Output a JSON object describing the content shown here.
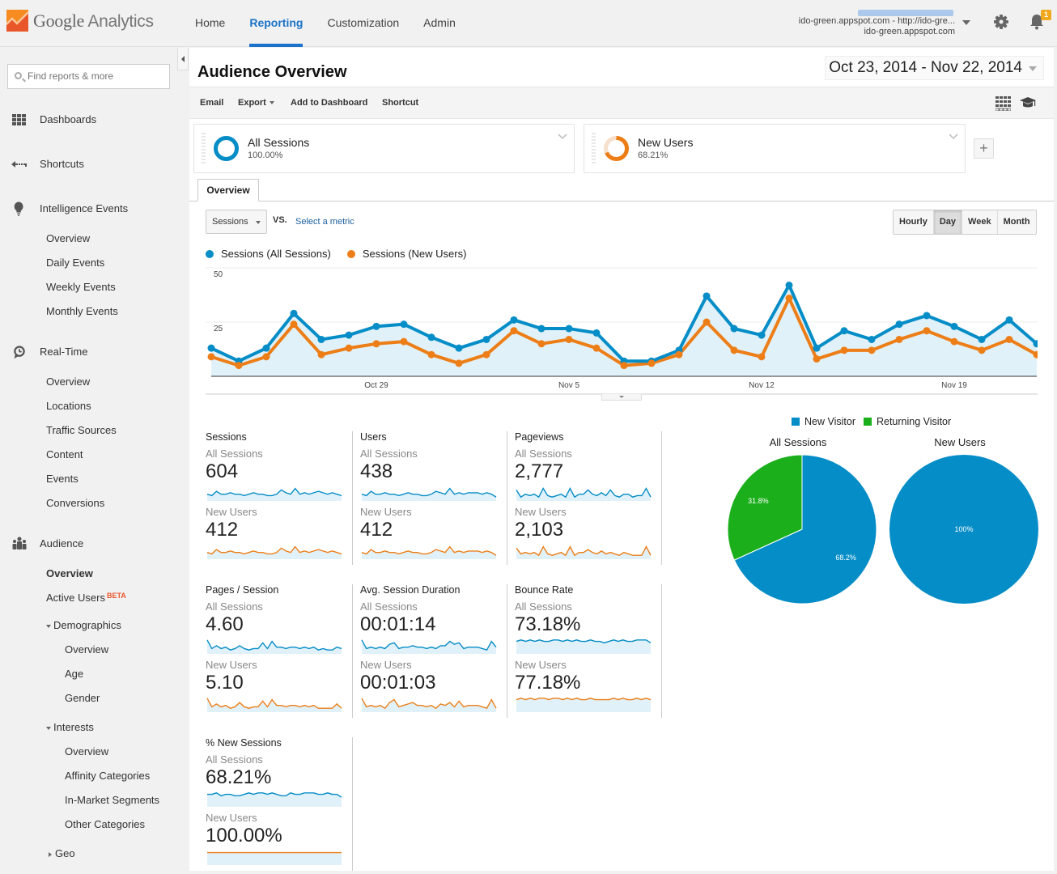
{
  "app": {
    "name_google": "Google",
    "name_analytics": "Analytics"
  },
  "nav": {
    "items": [
      {
        "label": "Home",
        "active": false
      },
      {
        "label": "Reporting",
        "active": true
      },
      {
        "label": "Customization",
        "active": false
      },
      {
        "label": "Admin",
        "active": false
      }
    ]
  },
  "account": {
    "line1": "ido-green.appspot.com - http://ido-gre...",
    "line2": "ido-green.appspot.com",
    "notifications": "1"
  },
  "sidebar": {
    "search_placeholder": "Find reports & more",
    "sections": {
      "dashboards": "Dashboards",
      "shortcuts": "Shortcuts",
      "intelligence": "Intelligence Events",
      "realtime": "Real-Time",
      "audience": "Audience"
    },
    "intelligence_items": [
      "Overview",
      "Daily Events",
      "Weekly Events",
      "Monthly Events"
    ],
    "realtime_items": [
      "Overview",
      "Locations",
      "Traffic Sources",
      "Content",
      "Events",
      "Conversions"
    ],
    "audience_items": {
      "overview": "Overview",
      "active_users": "Active Users",
      "beta": "BETA",
      "demographics": "Demographics",
      "demographics_items": [
        "Overview",
        "Age",
        "Gender"
      ],
      "interests": "Interests",
      "interests_items": [
        "Overview",
        "Affinity Categories",
        "In-Market Segments",
        "Other Categories"
      ],
      "geo": "Geo"
    }
  },
  "page": {
    "title": "Audience Overview",
    "date_range": "Oct 23, 2014 - Nov 22, 2014",
    "toolbar": {
      "email": "Email",
      "export": "Export",
      "add_to_dashboard": "Add to Dashboard",
      "shortcut": "Shortcut"
    },
    "segments": [
      {
        "name": "All Sessions",
        "percent": "100.00%",
        "fraction": 1.0,
        "color": "#058dc7"
      },
      {
        "name": "New Users",
        "percent": "68.21%",
        "fraction": 0.6821,
        "color": "#ed7e17"
      }
    ],
    "tab": "Overview",
    "metric_select": "Sessions",
    "vs": "VS.",
    "select_metric": "Select a metric",
    "granularity": [
      {
        "label": "Hourly",
        "active": false
      },
      {
        "label": "Day",
        "active": true
      },
      {
        "label": "Week",
        "active": false
      },
      {
        "label": "Month",
        "active": false
      }
    ]
  },
  "chart_data": [
    {
      "type": "line",
      "title": "",
      "xlabel": "",
      "ylabel": "",
      "ylim": [
        0,
        50
      ],
      "yticks": [
        25,
        50
      ],
      "grid": true,
      "legend": "top-left",
      "x_tick_labels": [
        {
          "label": "Oct 29",
          "index": 6
        },
        {
          "label": "Nov 5",
          "index": 13
        },
        {
          "label": "Nov 12",
          "index": 20
        },
        {
          "label": "Nov 19",
          "index": 27
        }
      ],
      "x": [
        "Oct 23",
        "Oct 24",
        "Oct 25",
        "Oct 26",
        "Oct 27",
        "Oct 28",
        "Oct 29",
        "Oct 30",
        "Oct 31",
        "Nov 1",
        "Nov 2",
        "Nov 3",
        "Nov 4",
        "Nov 5",
        "Nov 6",
        "Nov 7",
        "Nov 8",
        "Nov 9",
        "Nov 10",
        "Nov 11",
        "Nov 12",
        "Nov 13",
        "Nov 14",
        "Nov 15",
        "Nov 16",
        "Nov 17",
        "Nov 18",
        "Nov 19",
        "Nov 20",
        "Nov 21",
        "Nov 22"
      ],
      "series": [
        {
          "name": "Sessions (All Sessions)",
          "color": "#058dc7",
          "values": [
            13,
            7,
            13,
            29,
            17,
            19,
            23,
            24,
            18,
            13,
            17,
            26,
            22,
            22,
            20,
            7,
            7,
            12,
            37,
            22,
            19,
            42,
            13,
            21,
            17,
            24,
            28,
            23,
            17,
            26,
            15
          ]
        },
        {
          "name": "Sessions (New Users)",
          "color": "#ed7e17",
          "values": [
            9,
            5,
            9,
            24,
            10,
            13,
            15,
            16,
            10,
            6,
            10,
            21,
            15,
            17,
            13,
            5,
            6,
            10,
            25,
            12,
            9,
            36,
            8,
            12,
            12,
            17,
            21,
            16,
            12,
            17,
            10
          ]
        }
      ]
    },
    {
      "type": "pie",
      "legend": "top",
      "legend_entries": [
        {
          "name": "New Visitor",
          "color": "#058dc7"
        },
        {
          "name": "Returning Visitor",
          "color": "#1caf1c"
        }
      ],
      "pies": [
        {
          "title": "All Sessions",
          "slices": [
            {
              "name": "New Visitor",
              "value": 68.2,
              "label": "68.2%"
            },
            {
              "name": "Returning Visitor",
              "value": 31.8,
              "label": "31.8%"
            }
          ]
        },
        {
          "title": "New Users",
          "slices": [
            {
              "name": "New Visitor",
              "value": 100,
              "label": "100%"
            }
          ]
        }
      ]
    }
  ],
  "stats": [
    {
      "key": "sessions",
      "title": "Sessions",
      "seg1": "All Sessions",
      "val1": "604",
      "seg2": "New Users",
      "val2": "412",
      "spark1": [
        3,
        2,
        5,
        3,
        3,
        4,
        3,
        3,
        2,
        3,
        4,
        3,
        3,
        2,
        2,
        3,
        6,
        4,
        3,
        7,
        3,
        4,
        3,
        4,
        5,
        4,
        3,
        4,
        3,
        2
      ],
      "spark2": [
        3,
        2,
        5,
        3,
        3,
        4,
        3,
        3,
        2,
        3,
        4,
        3,
        3,
        2,
        2,
        3,
        6,
        4,
        3,
        7,
        3,
        4,
        3,
        4,
        5,
        4,
        3,
        4,
        3,
        2
      ]
    },
    {
      "key": "users",
      "title": "Users",
      "seg1": "All Sessions",
      "val1": "438",
      "seg2": "New Users",
      "val2": "412",
      "spark1": [
        3,
        2,
        5,
        3,
        3,
        4,
        3,
        3,
        2,
        3,
        4,
        3,
        3,
        2,
        2,
        3,
        5,
        4,
        3,
        7,
        3,
        4,
        3,
        4,
        4,
        4,
        3,
        4,
        3,
        1
      ],
      "spark2": [
        3,
        2,
        5,
        3,
        3,
        4,
        3,
        3,
        2,
        3,
        4,
        3,
        3,
        2,
        2,
        3,
        5,
        4,
        3,
        7,
        3,
        4,
        3,
        4,
        4,
        4,
        3,
        4,
        3,
        1
      ]
    },
    {
      "key": "pageviews",
      "title": "Pageviews",
      "seg1": "All Sessions",
      "val1": "2,777",
      "seg2": "New Users",
      "val2": "2,103",
      "spark1": [
        6,
        1,
        3,
        2,
        3,
        1,
        7,
        2,
        1,
        2,
        3,
        1,
        7,
        1,
        3,
        3,
        6,
        3,
        2,
        4,
        2,
        6,
        2,
        1,
        3,
        3,
        1,
        2,
        2,
        7,
        1
      ],
      "spark2": [
        6,
        2,
        3,
        2,
        3,
        1,
        7,
        2,
        1,
        2,
        3,
        1,
        7,
        1,
        3,
        3,
        5,
        3,
        2,
        4,
        2,
        3,
        2,
        1,
        3,
        2,
        1,
        1,
        1,
        7,
        1
      ]
    },
    {
      "key": "pages_per_session",
      "title": "Pages / Session",
      "seg1": "All Sessions",
      "val1": "4.60",
      "seg2": "New Users",
      "val2": "5.10",
      "spark1": [
        8,
        2,
        4,
        2,
        3,
        1,
        2,
        4,
        2,
        1,
        2,
        2,
        6,
        2,
        7,
        3,
        3,
        2,
        3,
        3,
        2,
        3,
        2,
        3,
        1,
        2,
        1,
        1,
        3,
        2
      ],
      "spark2": [
        8,
        2,
        4,
        2,
        3,
        1,
        2,
        5,
        2,
        1,
        2,
        2,
        6,
        2,
        7,
        3,
        3,
        2,
        3,
        3,
        2,
        3,
        2,
        3,
        1,
        1,
        1,
        1,
        4,
        1
      ]
    },
    {
      "key": "avg_session_duration",
      "title": "Avg. Session Duration",
      "seg1": "All Sessions",
      "val1": "00:01:14",
      "seg2": "New Users",
      "val2": "00:01:03",
      "spark1": [
        8,
        2,
        3,
        2,
        3,
        2,
        5,
        6,
        2,
        3,
        3,
        4,
        3,
        3,
        2,
        3,
        2,
        4,
        4,
        7,
        5,
        6,
        2,
        3,
        3,
        3,
        2,
        1,
        7,
        3
      ],
      "spark2": [
        8,
        2,
        3,
        2,
        3,
        1,
        5,
        7,
        2,
        3,
        4,
        5,
        3,
        3,
        2,
        3,
        1,
        4,
        3,
        5,
        2,
        6,
        2,
        3,
        3,
        3,
        2,
        1,
        7,
        1
      ]
    },
    {
      "key": "bounce_rate",
      "title": "Bounce Rate",
      "seg1": "All Sessions",
      "val1": "73.18%",
      "seg2": "New Users",
      "val2": "77.18%",
      "spark1": [
        7,
        8,
        7,
        8,
        7,
        8,
        7,
        7,
        8,
        8,
        7,
        8,
        7,
        8,
        7,
        7,
        8,
        7,
        7,
        6,
        7,
        8,
        7,
        8,
        7,
        7,
        8,
        8,
        8,
        6
      ],
      "spark2": [
        7,
        8,
        7,
        8,
        7,
        8,
        8,
        7,
        8,
        8,
        7,
        8,
        7,
        8,
        7,
        7,
        8,
        7,
        7,
        7,
        7,
        8,
        7,
        8,
        7,
        7,
        8,
        7,
        8,
        7
      ]
    },
    {
      "key": "pct_new_sessions",
      "title": "% New Sessions",
      "seg1": "All Sessions",
      "val1": "68.21%",
      "seg2": "New Users",
      "val2": "100.00%",
      "spark1": [
        7,
        7,
        8,
        6,
        7,
        7,
        6,
        6,
        7,
        8,
        7,
        8,
        8,
        7,
        8,
        7,
        6,
        6,
        8,
        7,
        7,
        8,
        8,
        8,
        7,
        7,
        8,
        7,
        7,
        5
      ],
      "spark2": [
        7,
        7,
        7,
        7,
        7,
        7,
        7,
        7,
        7,
        7,
        7,
        7,
        7,
        7,
        7,
        7,
        7,
        7,
        7,
        7,
        7,
        7,
        7,
        7,
        7,
        7,
        7,
        7,
        7,
        7
      ]
    }
  ]
}
